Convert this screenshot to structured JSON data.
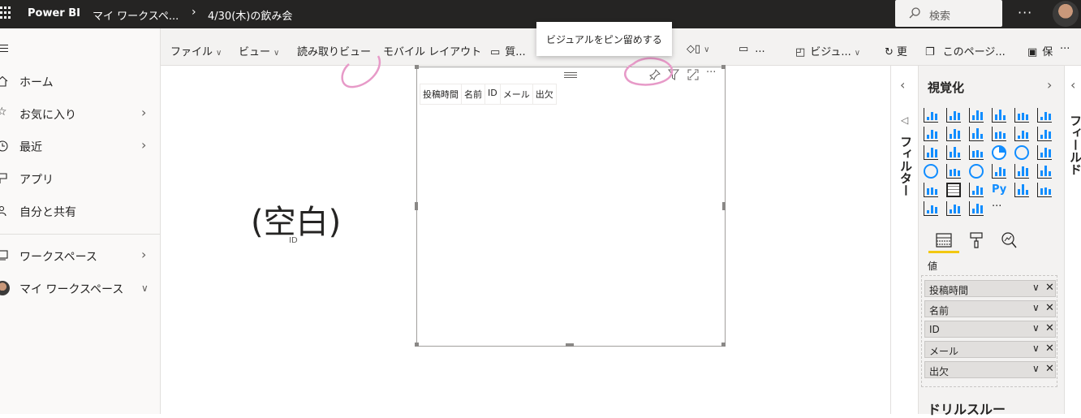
{
  "topbar": {
    "brand": "Power BI",
    "breadcrumb_workspace": "マイ ワークスペ...",
    "breadcrumb_report": "4/30(木)の飲み会",
    "search_placeholder": "検索",
    "more": "···"
  },
  "left_nav": {
    "items": [
      {
        "label": "ホーム",
        "icon": "home-icon"
      },
      {
        "label": "お気に入り",
        "icon": "star-icon"
      },
      {
        "label": "最近",
        "icon": "clock-icon"
      },
      {
        "label": "アプリ",
        "icon": "apps-icon"
      },
      {
        "label": "自分と共有",
        "icon": "shared-icon"
      },
      {
        "label": "ワークスペース",
        "icon": "workspaces-icon"
      },
      {
        "label": "マイ ワークスペース",
        "icon": "avatar"
      }
    ]
  },
  "toolbar": {
    "file": "ファイル",
    "view": "ビュー",
    "reading_view": "読み取りビュー",
    "mobile_layout": "モバイル レイアウト",
    "qa": "質...",
    "textbox": "...",
    "visual": "ビジュ...",
    "refresh": "更",
    "this_page": "このページ...",
    "save": "保",
    "more": "···"
  },
  "tooltip": "ビジュアルをピン留めする",
  "card": {
    "value": "(空白)",
    "label": "ID"
  },
  "table_visual": {
    "columns": [
      "投稿時間",
      "名前",
      "ID",
      "メール",
      "出欠"
    ]
  },
  "filters_pane": {
    "label": "フィルター"
  },
  "viz_pane": {
    "title": "視覚化",
    "value_label": "値",
    "wells": [
      "投稿時間",
      "名前",
      "ID",
      "メール",
      "出欠"
    ],
    "drillthrough": "ドリルスルー",
    "python_label": "Py",
    "more": "···"
  },
  "fields_pane": {
    "label": "フィールド"
  },
  "colors": {
    "accent": "#f2c811",
    "topbar": "#252423",
    "viz_blue": "#118dff"
  }
}
